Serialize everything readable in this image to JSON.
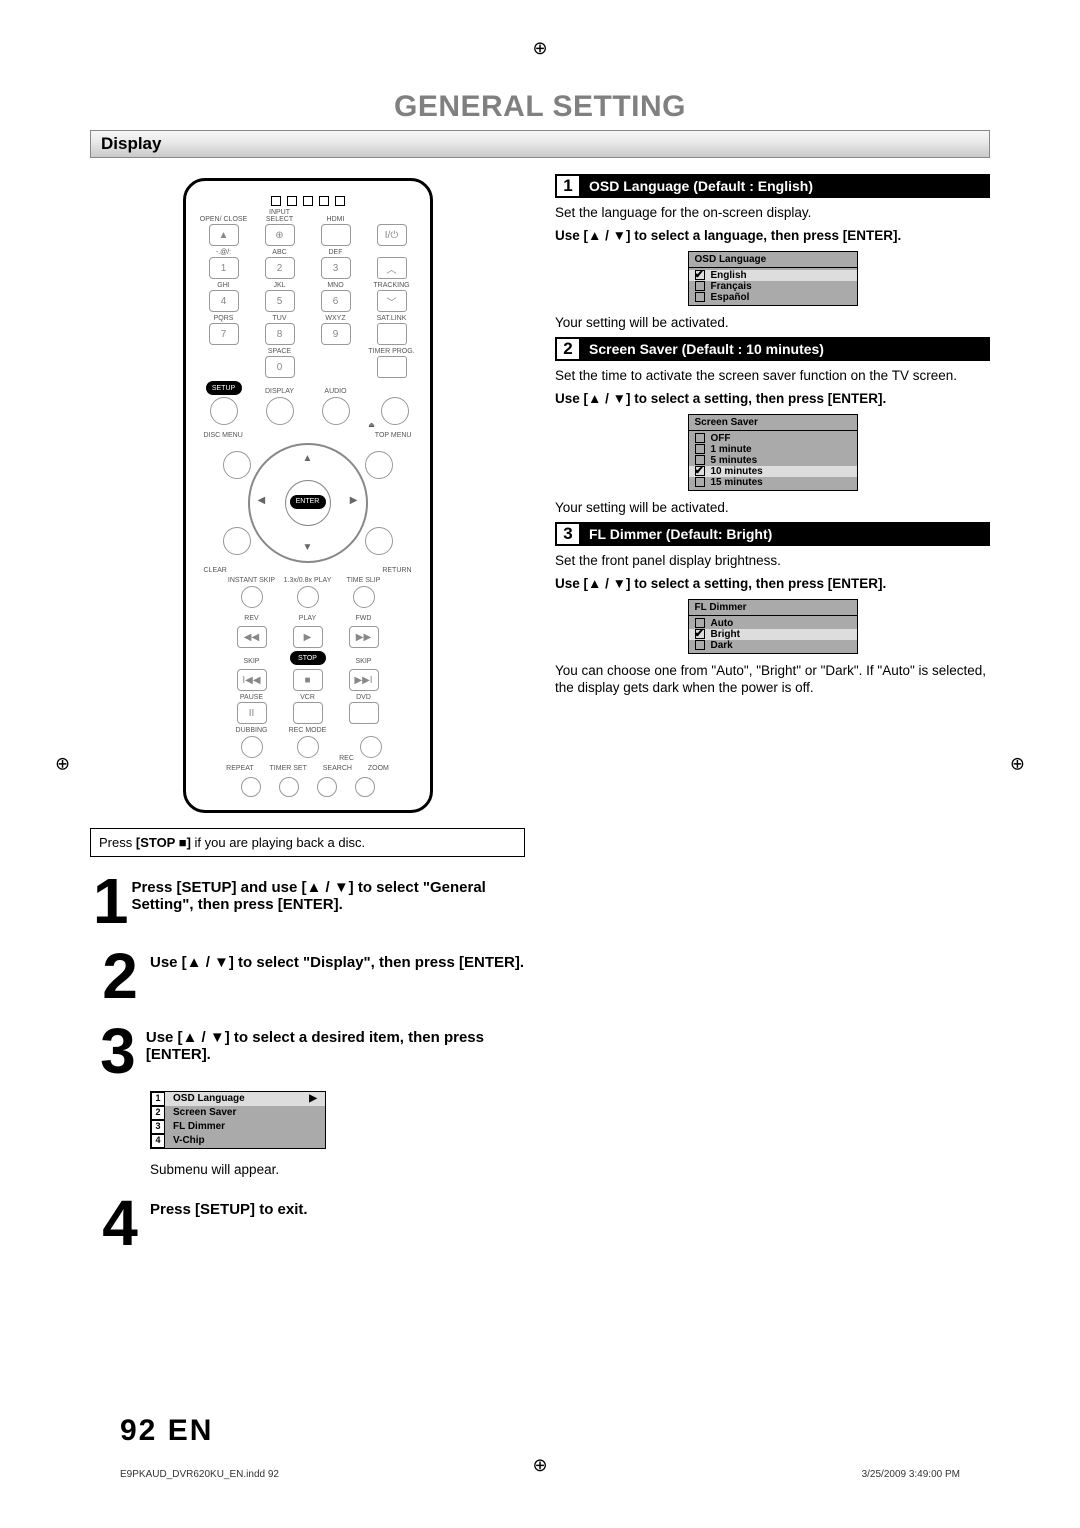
{
  "page": {
    "title": "GENERAL SETTING",
    "section": "Display",
    "pagenum_label": "92  EN",
    "footer_file": "E9PKAUD_DVR620KU_EN.indd   92",
    "footer_date": "3/25/2009   3:49:00 PM"
  },
  "remote": {
    "top_labels": [
      "OPEN/\nCLOSE",
      "INPUT\nSELECT",
      "HDMI"
    ],
    "rows": [
      {
        "labels": [
          "-.@/:",
          "ABC",
          "DEF"
        ],
        "nums": [
          "1",
          "2",
          "3"
        ]
      },
      {
        "labels": [
          "GHI",
          "JKL",
          "MNO"
        ],
        "nums": [
          "4",
          "5",
          "6"
        ],
        "side": "TRACKING"
      },
      {
        "labels": [
          "PQRS",
          "TUV",
          "WXYZ"
        ],
        "nums": [
          "7",
          "8",
          "9"
        ],
        "side": "SAT.LINK"
      }
    ],
    "space_label": "SPACE",
    "zero": "0",
    "timer_prog": "TIMER\nPROG.",
    "mid_labels": [
      "SETUP",
      "DISPLAY",
      "AUDIO"
    ],
    "disc_menu": "DISC MENU",
    "top_menu": "TOP MENU",
    "enter": "ENTER",
    "clear": "CLEAR",
    "ret": "RETURN",
    "slip_labels": [
      "INSTANT\nSKIP",
      "1.3x/0.8x\nPLAY",
      "TIME SLIP"
    ],
    "play_row": [
      "REV",
      "PLAY",
      "FWD"
    ],
    "skip_row": [
      "SKIP",
      "STOP",
      "SKIP"
    ],
    "pause": "PAUSE",
    "vcr": "VCR",
    "dvd": "DVD",
    "dubbing": "DUBBING",
    "recmode": "REC MODE",
    "rec": "REC",
    "bottom": [
      "REPEAT",
      "TIMER SET",
      "SEARCH",
      "ZOOM"
    ]
  },
  "caption": {
    "pre": "Press ",
    "stop": "STOP",
    "post": " if you are playing back a disc."
  },
  "steps": [
    "Press [SETUP] and use [▲ / ▼] to select \"General Setting\", then press [ENTER].",
    "Use [▲ / ▼] to select \"Display\", then press [ENTER].",
    "Use [▲ / ▼] to select a desired item, then press [ENTER].",
    "Press [SETUP] to exit."
  ],
  "submenu": {
    "items": [
      "OSD Language",
      "Screen Saver",
      "FL Dimmer",
      "V-Chip"
    ],
    "selected_index": 0,
    "note": "Submenu will appear."
  },
  "settings": [
    {
      "title": "OSD Language (Default : English)",
      "desc": "Set the language for the on-screen display.",
      "instr": "Use [▲ / ▼] to select a language, then press [ENTER].",
      "header": "OSD Language",
      "options": [
        {
          "label": "English",
          "sel": true
        },
        {
          "label": "Français",
          "sel": false
        },
        {
          "label": "Español",
          "sel": false
        }
      ],
      "after": "Your setting will be activated."
    },
    {
      "title": "Screen Saver (Default : 10 minutes)",
      "desc": "Set the time to activate the screen saver function on the TV screen.",
      "instr": "Use [▲ / ▼] to select a setting, then press [ENTER].",
      "header": "Screen Saver",
      "options": [
        {
          "label": "OFF",
          "sel": false
        },
        {
          "label": "1 minute",
          "sel": false
        },
        {
          "label": "5 minutes",
          "sel": false
        },
        {
          "label": "10 minutes",
          "sel": true
        },
        {
          "label": "15 minutes",
          "sel": false
        }
      ],
      "after": "Your setting will be activated."
    },
    {
      "title": "FL Dimmer (Default: Bright)",
      "desc": "Set the front panel display brightness.",
      "instr": "Use [▲ / ▼] to select a setting, then press [ENTER].",
      "header": "FL Dimmer",
      "options": [
        {
          "label": "Auto",
          "sel": false
        },
        {
          "label": "Bright",
          "sel": true
        },
        {
          "label": "Dark",
          "sel": false
        }
      ],
      "after": "You can choose one from \"Auto\", \"Bright\" or \"Dark\". If \"Auto\" is selected, the display gets dark when the power is off."
    }
  ]
}
